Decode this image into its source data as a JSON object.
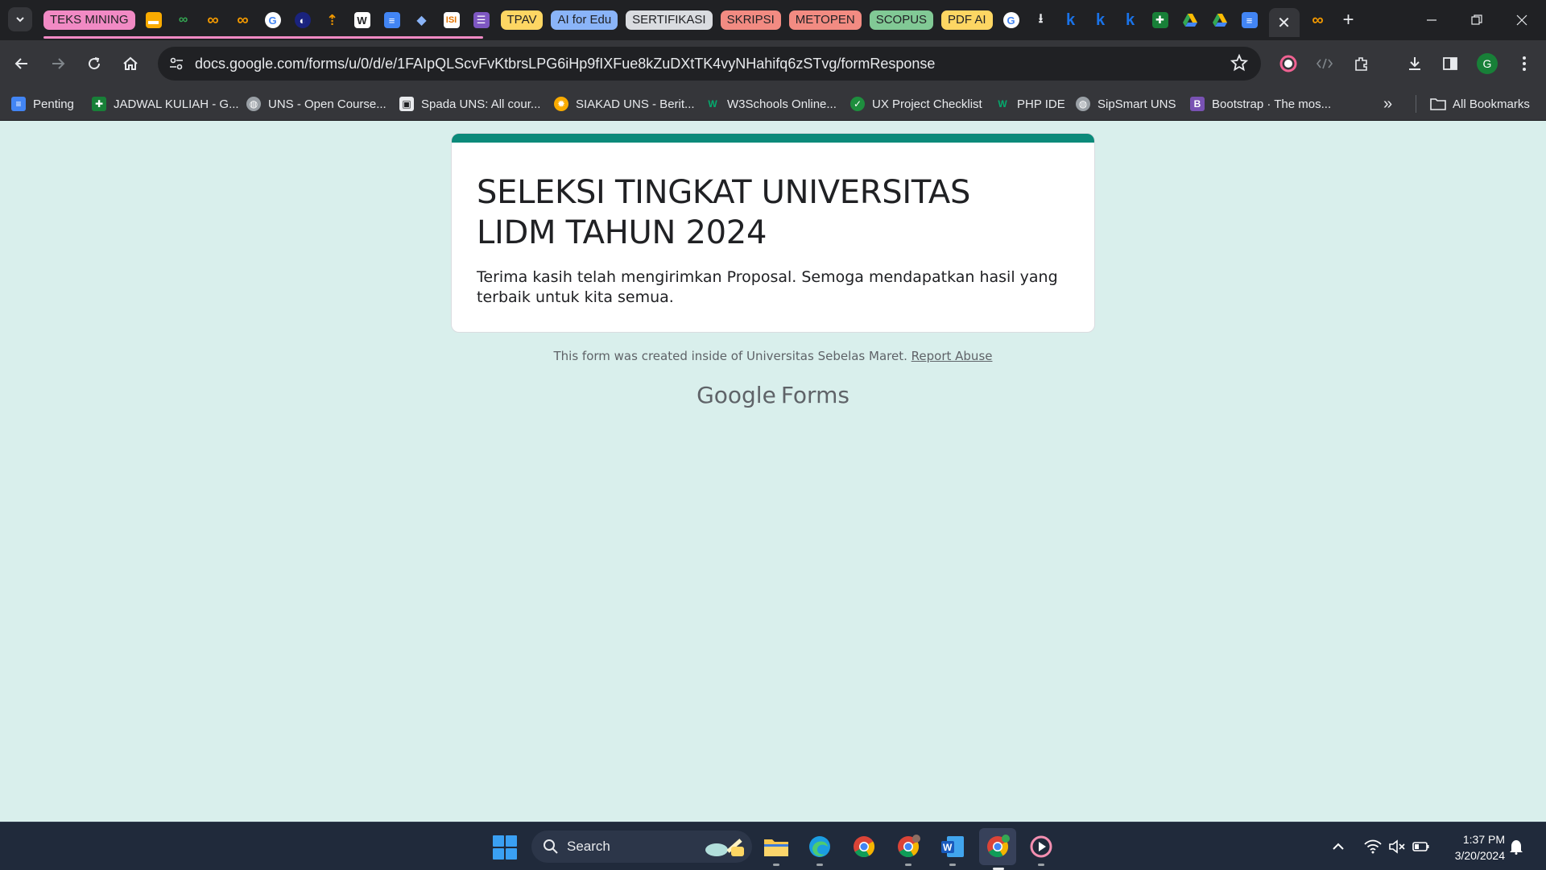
{
  "browser": {
    "tab_groups": [
      {
        "label": "TEKS MINING",
        "color": "#f18ac4"
      },
      {
        "label": "TPAV",
        "color": "#fdd663"
      },
      {
        "label": "AI for Edu",
        "color": "#8ab4f8"
      },
      {
        "label": "SERTIFIKASI",
        "color": "#dadce0"
      },
      {
        "label": "SKRIPSI",
        "color": "#f28b82"
      },
      {
        "label": "METOPEN",
        "color": "#f28b82"
      },
      {
        "label": "SCOPUS",
        "color": "#81c995"
      },
      {
        "label": "PDF AI",
        "color": "#fdd663"
      }
    ],
    "active_tab_close": "✕",
    "new_tab": "+",
    "url": "docs.google.com/forms/u/0/d/e/1FAIpQLScvFvKtbrsLPG6iHp9fIXFue8kZuDXtTK4vyNHahifq6zSTvg/formResponse",
    "profile_initial": "G",
    "bookmarks": [
      {
        "label": "Penting",
        "icon": "docs-icon",
        "color": "#4285f4"
      },
      {
        "label": "JADWAL KULIAH - G...",
        "icon": "sheets-icon",
        "color": "#188038"
      },
      {
        "label": "UNS - Open Course...",
        "icon": "globe-icon",
        "color": "#9aa0a6"
      },
      {
        "label": "Spada UNS: All cour...",
        "icon": "spada-icon",
        "color": "#9aa0a6"
      },
      {
        "label": "SIAKAD UNS - Berit...",
        "icon": "siakad-icon",
        "color": "#f9ab00"
      },
      {
        "label": "W3Schools Online...",
        "icon": "w3schools-icon",
        "color": "#04aa6d"
      },
      {
        "label": "UX Project Checklist",
        "icon": "check-icon",
        "color": "#1e8e3e"
      },
      {
        "label": "PHP IDE",
        "icon": "w-icon",
        "color": "#04aa6d"
      },
      {
        "label": "SipSmart UNS",
        "icon": "globe-icon",
        "color": "#9aa0a6"
      },
      {
        "label": "Bootstrap · The mos...",
        "icon": "bootstrap-icon",
        "color": "#7952b3"
      }
    ],
    "more_bookmarks": "»",
    "all_bookmarks": "All Bookmarks"
  },
  "form": {
    "accent": "#0b8a7a",
    "title": "SELEKSI TINGKAT UNIVERSITAS LIDM TAHUN 2024",
    "message": "Terima kasih telah mengirimkan Proposal. Semoga mendapatkan hasil yang terbaik untuk kita semua.",
    "footer_text": "This form was created inside of Universitas Sebelas Maret.",
    "report_abuse": "Report Abuse",
    "brand_google": "Google",
    "brand_forms": "Forms"
  },
  "taskbar": {
    "search_label": "Search",
    "time": "1:37 PM",
    "date": "3/20/2024"
  }
}
